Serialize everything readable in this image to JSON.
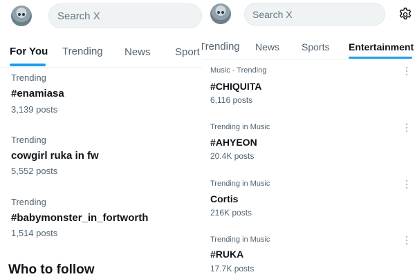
{
  "left": {
    "search_placeholder": "Search X",
    "tabs": [
      {
        "label": "For You",
        "active": true
      },
      {
        "label": "Trending",
        "active": false
      },
      {
        "label": "News",
        "active": false
      },
      {
        "label": "Sport",
        "active": false
      }
    ],
    "trends": [
      {
        "context": "Trending",
        "name": "#enamiasa",
        "count": "3,139 posts"
      },
      {
        "context": "Trending",
        "name": "cowgirl ruka in fw",
        "count": "5,552 posts"
      },
      {
        "context": "Trending",
        "name": "#babymonster_in_fortworth",
        "count": "1,514 posts"
      }
    ],
    "section_title": "Who to follow"
  },
  "right": {
    "search_placeholder": "Search X",
    "tabs": [
      {
        "label": "Trending",
        "active": false
      },
      {
        "label": "News",
        "active": false
      },
      {
        "label": "Sports",
        "active": false
      },
      {
        "label": "Entertainment",
        "active": true
      }
    ],
    "trends": [
      {
        "context": "Music · Trending",
        "name": "#CHIQUITA",
        "count": "6,116 posts"
      },
      {
        "context": "Trending in Music",
        "name": "#AHYEON",
        "count": "20.4K posts"
      },
      {
        "context": "Trending in Music",
        "name": "Cortis",
        "count": "216K posts"
      },
      {
        "context": "Trending in Music",
        "name": "#RUKA",
        "count": "17.7K posts"
      }
    ]
  },
  "colors": {
    "accent": "#1d9bf0",
    "text": "#0f1419",
    "secondary": "#536471"
  },
  "icons": {
    "settings": "gear-icon",
    "more": "more-dots-icon",
    "avatar": "avatar"
  }
}
